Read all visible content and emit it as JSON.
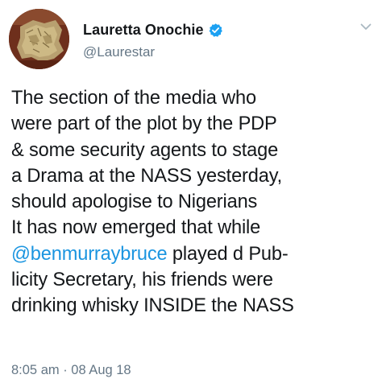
{
  "user": {
    "display_name": "Lauretta Onochie",
    "handle": "@Laurestar",
    "verified": true,
    "avatar_icon": "map-artwork-avatar"
  },
  "tweet": {
    "lines": [
      "The section of the media who",
      "were part of the plot by the PDP",
      "& some security agents to stage",
      "a Drama at the NASS yesterday,",
      "should apologise to Nigerians",
      "It has now emerged that while"
    ],
    "mention_line": {
      "mention": "@benmurraybruce",
      "after": " played d Pub-"
    },
    "trailing_lines": [
      "licity Secretary, his friends were",
      "drinking whisky INSIDE the NASS"
    ]
  },
  "meta": {
    "timestamp": "8:05 am · 08 Aug 18"
  },
  "colors": {
    "text": "#14171a",
    "secondary": "#657786",
    "link": "#1b95e0",
    "verified": "#1da1f2"
  },
  "icons": {
    "verified": "verified-badge-icon",
    "menu": "chevron-down-icon"
  }
}
